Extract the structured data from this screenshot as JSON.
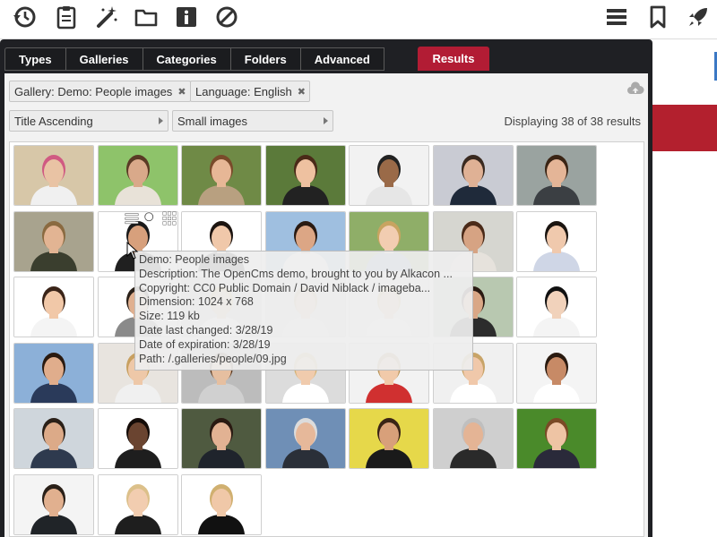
{
  "toolbar": {
    "left_icons": [
      "history-icon",
      "clipboard-icon",
      "magic-wand-icon",
      "folder-icon",
      "info-icon",
      "disable-icon"
    ],
    "right_icons": [
      "menu-icon",
      "bookmark-icon",
      "rocket-icon"
    ]
  },
  "dialog": {
    "tabs": [
      "Types",
      "Galleries",
      "Categories",
      "Folders",
      "Advanced"
    ],
    "results_tab": "Results",
    "accent_color": "#b21c34",
    "filters": [
      {
        "label": "Gallery: Demo: People images"
      },
      {
        "label": "Language: English"
      }
    ],
    "sort_select": "Title Ascending",
    "size_select": "Small images",
    "result_count": "Displaying 38 of 38 results"
  },
  "tooltip": {
    "lines": [
      "Demo: People images",
      "Description: The OpenCms demo, brought to you by Alkacon ...",
      "Copyright: CC0 Public Domain / David Niblack / imageba...",
      "Dimension: 1024 x 768",
      "Size: 119 kb",
      "Date last changed: 3/28/19",
      "Date of expiration: 3/28/19",
      "Path: /.galleries/people/09.jpg"
    ]
  },
  "thumbnails": [
    {
      "bg": "#d7c7a8",
      "skin": "#e9c3a4",
      "hair": "#d05a82",
      "shirt": "#f0f0f0"
    },
    {
      "bg": "#8ec36a",
      "skin": "#d9a98a",
      "hair": "#5a3a25",
      "shirt": "#e8e2d8"
    },
    {
      "bg": "#6f8a46",
      "skin": "#e7b796",
      "hair": "#7a4a2a",
      "shirt": "#b8a080"
    },
    {
      "bg": "#5b7a3a",
      "skin": "#eec1a0",
      "hair": "#4a2a18",
      "shirt": "#222222"
    },
    {
      "bg": "#f2f2f2",
      "skin": "#9a6a48",
      "hair": "#222222",
      "shirt": "#e6e6e6"
    },
    {
      "bg": "#c9cbd3",
      "skin": "#dfb195",
      "hair": "#3a2a20",
      "shirt": "#1f2a3a"
    },
    {
      "bg": "#9aa3a0",
      "skin": "#e4b597",
      "hair": "#3a2414",
      "shirt": "#3b3f43"
    },
    {
      "bg": "#a8a38e",
      "skin": "#e2b493",
      "hair": "#8a6a40",
      "shirt": "#3a3e2e"
    },
    {
      "bg": "#ffffff",
      "skin": "#d7a07c",
      "hair": "#1a1a1a",
      "shirt": "#202020"
    },
    {
      "bg": "#ffffff",
      "skin": "#f0c8aa",
      "hair": "#1c1410",
      "shirt": "#222222"
    },
    {
      "bg": "#9fbfe0",
      "skin": "#dca685",
      "hair": "#2a1a12",
      "shirt": "#ffffff"
    },
    {
      "bg": "#8fae68",
      "skin": "#f2cdb1",
      "hair": "#c8a460",
      "shirt": "#7ca0c8"
    },
    {
      "bg": "#d6d6d0",
      "skin": "#d6a383",
      "hair": "#4a2a18",
      "shirt": "#e6e2dc"
    },
    {
      "bg": "#ffffff",
      "skin": "#f0c9ad",
      "hair": "#1a1410",
      "shirt": "#cfd6e6"
    },
    {
      "bg": "#ffffff",
      "skin": "#f1c8a8",
      "hair": "#3a2418",
      "shirt": "#f4f4f4"
    },
    {
      "bg": "#ffffff",
      "skin": "#e0b090",
      "hair": "#2a2018",
      "shirt": "#8a8a8a"
    },
    {
      "bg": "#d0d0d0",
      "skin": "#e4c0a0",
      "hair": "#d7b06a",
      "shirt": "#f4f4f4"
    },
    {
      "bg": "#d8d8d8",
      "skin": "#e9c5a5",
      "hair": "#c8a870",
      "shirt": "#eeeeee"
    },
    {
      "bg": "#e8e8e8",
      "skin": "#ebc6a8",
      "hair": "#d0b070",
      "shirt": "#ffffff"
    },
    {
      "bg": "#b8c8b0",
      "skin": "#d9a786",
      "hair": "#2a1a12",
      "shirt": "#2c2c2c"
    },
    {
      "bg": "#ffffff",
      "skin": "#f1d2bb",
      "hair": "#111111",
      "shirt": "#f4f4f4"
    },
    {
      "bg": "#8cb0d8",
      "skin": "#e0ad8c",
      "hair": "#2a1a10",
      "shirt": "#2a3a5a"
    },
    {
      "bg": "#e8e4df",
      "skin": "#eec8a8",
      "hair": "#c8a060",
      "shirt": "#f0f0f0"
    },
    {
      "bg": "#bcbcbc",
      "skin": "#e6bfa0",
      "hair": "#5a3a22",
      "shirt": "#d0d0d0"
    },
    {
      "bg": "#dcdcdc",
      "skin": "#f0cbad",
      "hair": "#d4b274",
      "shirt": "#ffffff"
    },
    {
      "bg": "#f2f2f2",
      "skin": "#f1caaa",
      "hair": "#b8945a",
      "shirt": "#d03030"
    },
    {
      "bg": "#f0f0f0",
      "skin": "#f0c8aa",
      "hair": "#c8a468",
      "shirt": "#ffffff"
    },
    {
      "bg": "#f4f4f4",
      "skin": "#c78a66",
      "hair": "#2a1a10",
      "shirt": "#ffffff"
    },
    {
      "bg": "#cfd6dc",
      "skin": "#dcaa88",
      "hair": "#2a2018",
      "shirt": "#2e3a4e"
    },
    {
      "bg": "#ffffff",
      "skin": "#6a4430",
      "hair": "#140c08",
      "shirt": "#1e1e1e"
    },
    {
      "bg": "#4f5a40",
      "skin": "#e2b293",
      "hair": "#2a1a12",
      "shirt": "#1f242c"
    },
    {
      "bg": "#6f8fb6",
      "skin": "#e6b89a",
      "hair": "#dcdcdc",
      "shirt": "#2a2f38"
    },
    {
      "bg": "#e6d84a",
      "skin": "#d8a07a",
      "hair": "#3a2416",
      "shirt": "#1a1a1a"
    },
    {
      "bg": "#cfcfcf",
      "skin": "#e4b495",
      "hair": "#bfbfbf",
      "shirt": "#2a2a2a"
    },
    {
      "bg": "#4a8a2a",
      "skin": "#eec4a4",
      "hair": "#7a4a26",
      "shirt": "#2a2a3a"
    },
    {
      "bg": "#f4f4f4",
      "skin": "#e1b08f",
      "hair": "#2a2018",
      "shirt": "#202428"
    },
    {
      "bg": "#ffffff",
      "skin": "#f2cdb0",
      "hair": "#dcc08a",
      "shirt": "#1e1e1e"
    },
    {
      "bg": "#ffffff",
      "skin": "#f0c8a8",
      "hair": "#d0b070",
      "shirt": "#111111"
    }
  ]
}
